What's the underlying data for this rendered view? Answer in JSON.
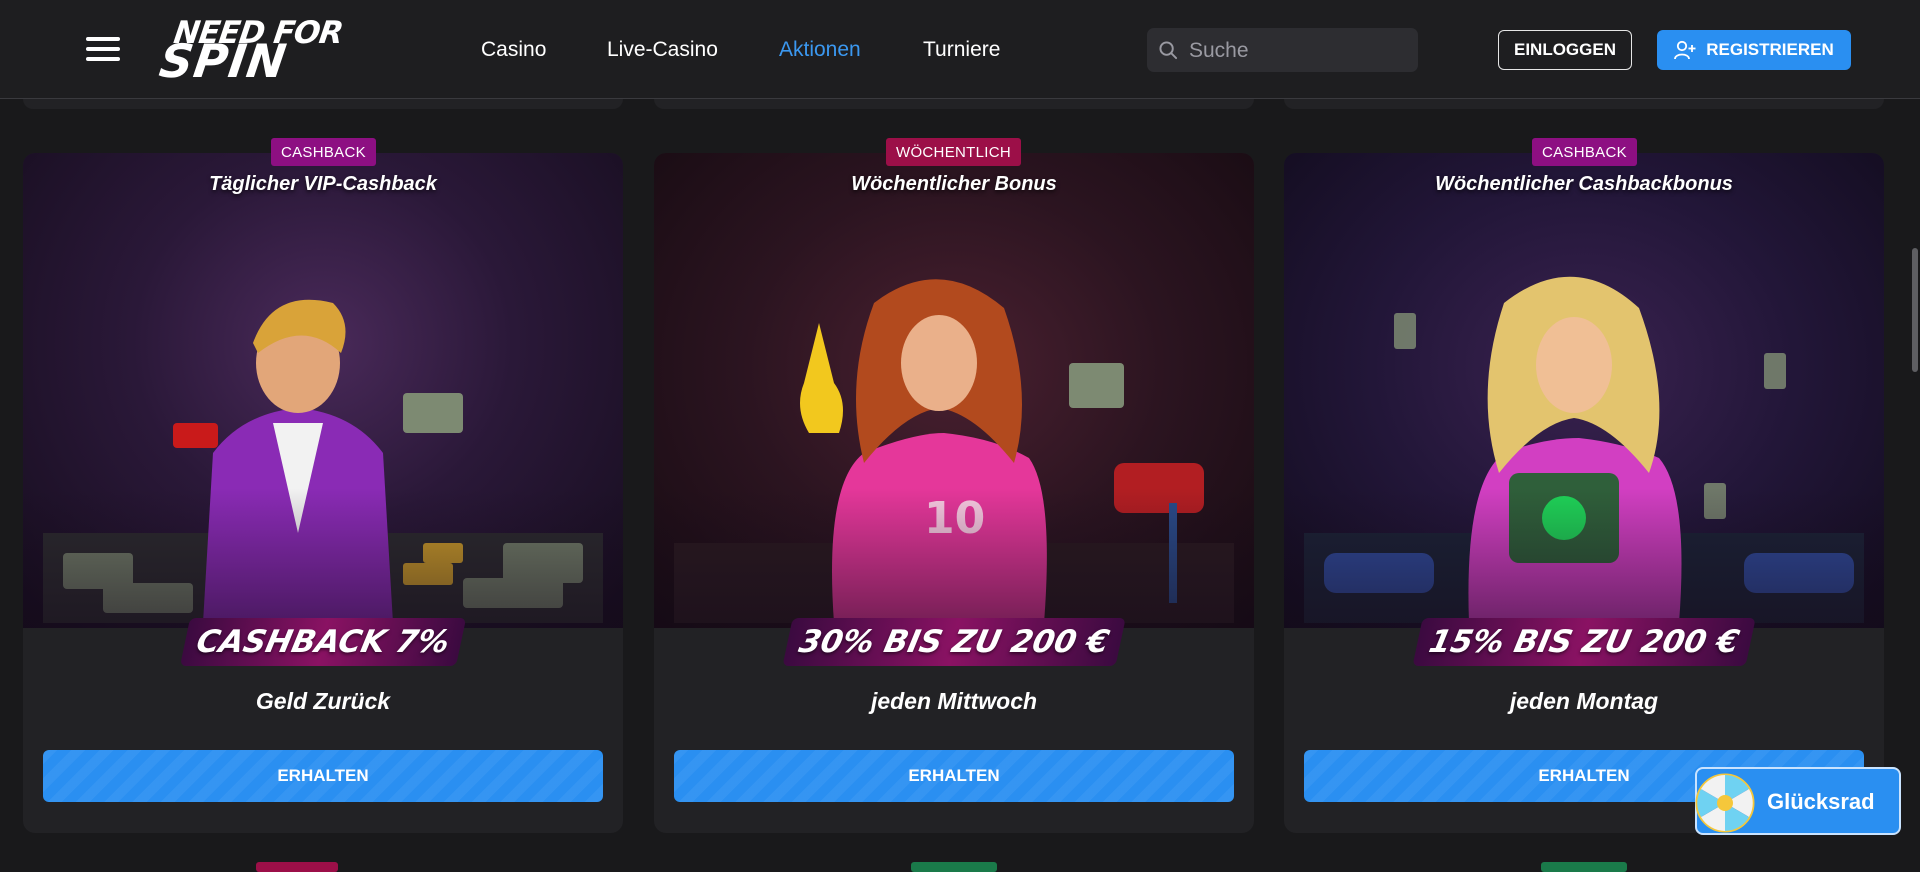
{
  "header": {
    "logo_line1": "NEED FOR",
    "logo_line2": "SPIN",
    "nav": [
      "Casino",
      "Live-Casino",
      "Aktionen",
      "Turniere"
    ],
    "active_nav": "Aktionen",
    "search_placeholder": "Suche",
    "login_label": "EINLOGGEN",
    "register_label": "REGISTRIEREN"
  },
  "colors": {
    "accent": "#2a8ff1",
    "active_nav": "#3b98f0",
    "tag_purple": "#8d0f82",
    "tag_red": "#9c0f48",
    "tag_green": "#1a7a4a"
  },
  "cards": [
    {
      "tag": "CASHBACK",
      "title": "Täglicher VIP-Cashback",
      "banner": "CASHBACK 7%",
      "subtitle": "Geld Zurück",
      "button": "ERHALTEN",
      "image": "man-with-money-gun"
    },
    {
      "tag": "WÖCHENTLICH",
      "title": "Wöchentlicher Bonus",
      "banner": "30% BIS ZU 200 €",
      "subtitle": "jeden Mittwoch",
      "button": "ERHALTEN",
      "image": "woman-in-pink-jersey-10"
    },
    {
      "tag": "CASHBACK",
      "title": "Wöchentlicher Cashbackbonus",
      "banner": "15% BIS ZU 200 €",
      "subtitle": "jeden Montag",
      "button": "ERHALTEN",
      "image": "woman-with-cash-briefcase"
    }
  ],
  "wheel": {
    "label": "Glücksrad",
    "icon": "fortune-wheel-icon"
  }
}
